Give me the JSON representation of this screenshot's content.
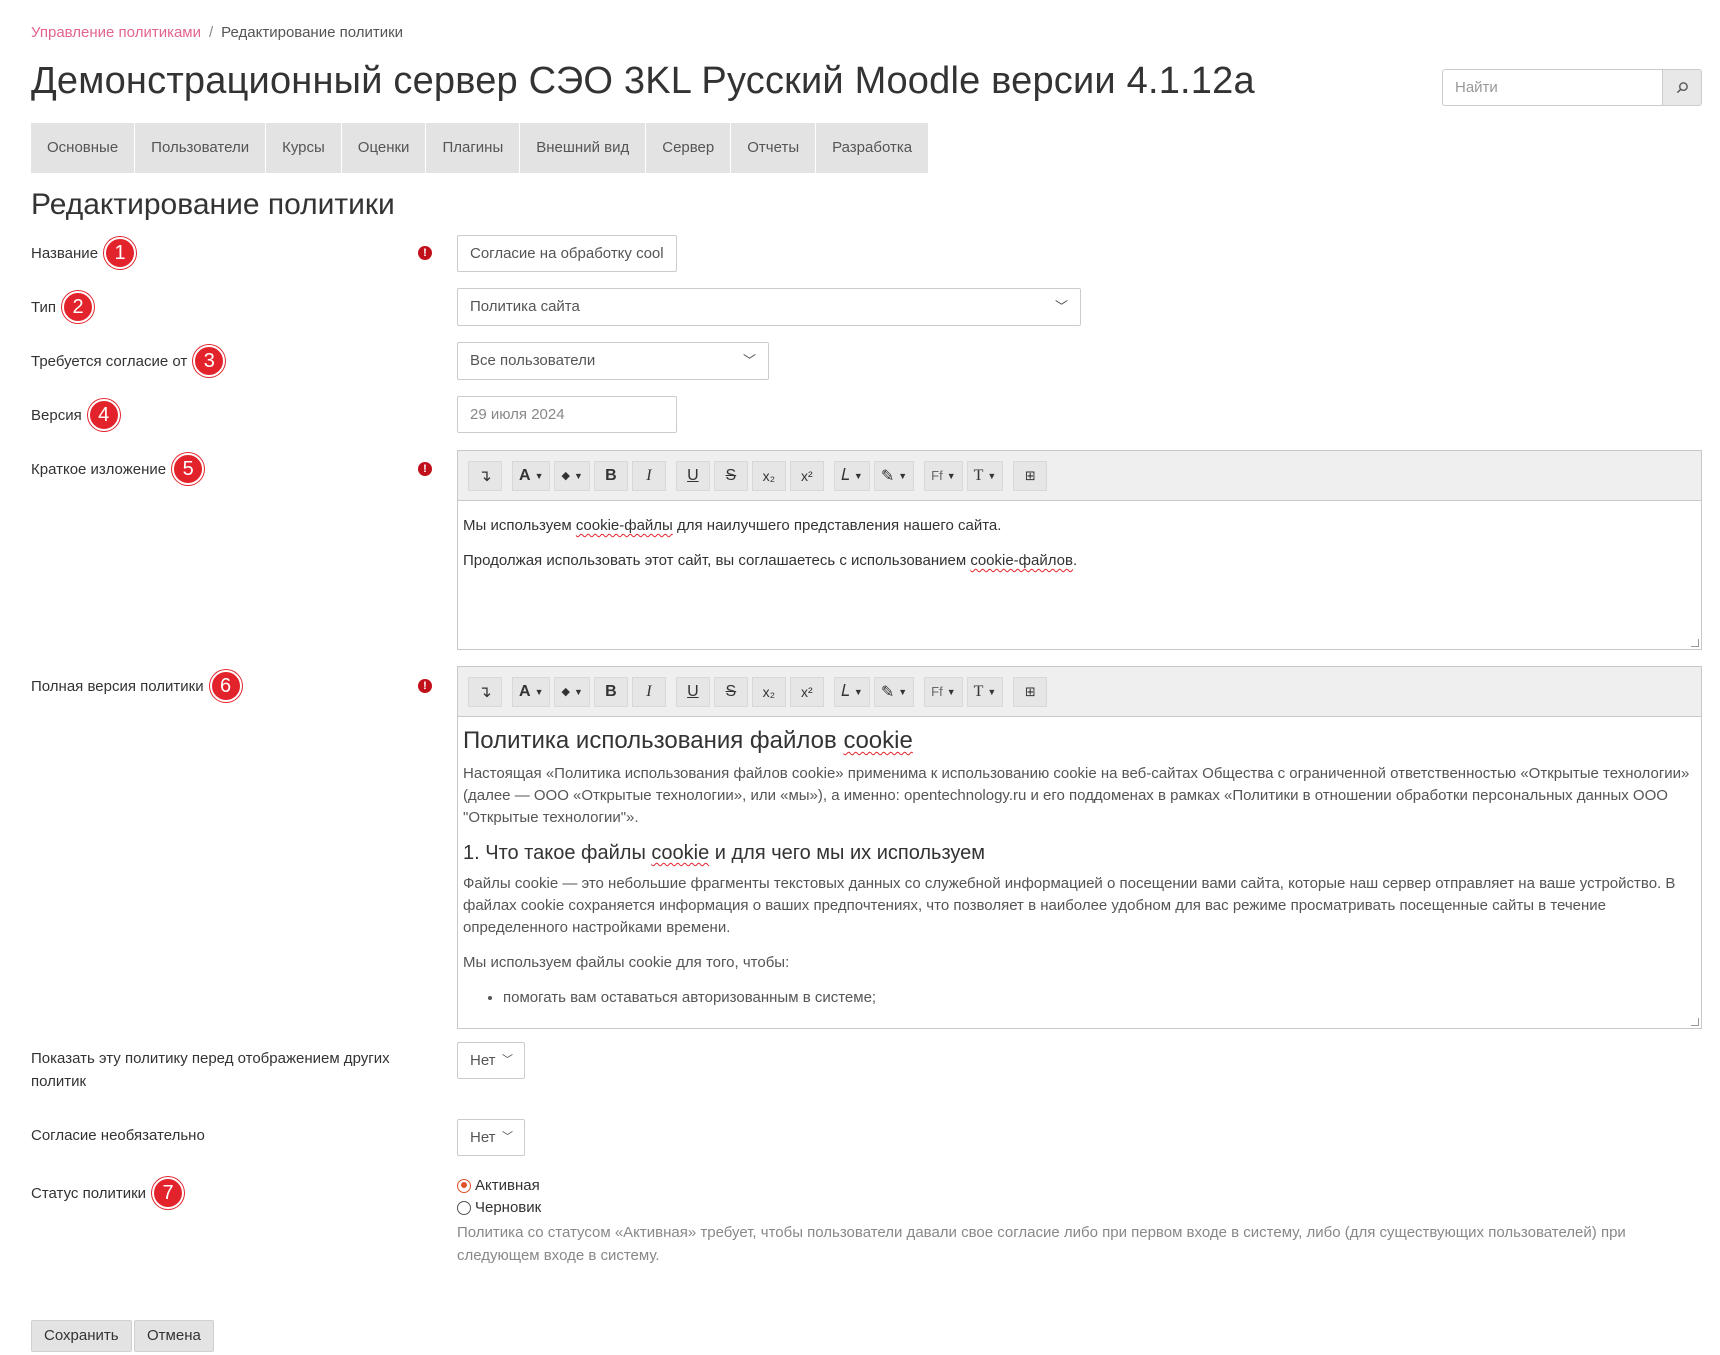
{
  "breadcrumb": {
    "link": "Управление политиками",
    "separator": "/",
    "current": "Редактирование политики"
  },
  "site_title": "Демонстрационный сервер СЭО 3KL Русский Moodle версии 4.1.12а",
  "search": {
    "placeholder": "Найти",
    "icon": "search-icon"
  },
  "nav": [
    "Основные",
    "Пользователи",
    "Курсы",
    "Оценки",
    "Плагины",
    "Внешний вид",
    "Сервер",
    "Отчеты",
    "Разработка"
  ],
  "page_heading": "Редактирование политики",
  "form": {
    "name": {
      "label": "Название",
      "badge": "1",
      "value": "Согласие на обработку cool"
    },
    "type": {
      "label": "Тип",
      "badge": "2",
      "value": "Политика сайта"
    },
    "audience": {
      "label": "Требуется согласие от",
      "badge": "3",
      "value": "Все пользователи"
    },
    "version": {
      "label": "Версия",
      "badge": "4",
      "value": "29 июля 2024"
    },
    "summary": {
      "label": "Краткое изложение",
      "badge": "5",
      "p1_a": "Мы используем ",
      "p1_b": "cookie-файлы",
      "p1_c": " для наилучшего представления нашего сайта.",
      "p2_a": "Продолжая использовать этот сайт, вы соглашаетесь с использованием ",
      "p2_b": "cookie-файлов",
      "p2_c": "."
    },
    "full": {
      "label": "Полная версия политики",
      "badge": "6",
      "title_a": "Политика использования файлов ",
      "title_b": "cookie",
      "intro": "Настоящая «Политика использования файлов cookie» применима к использованию cookie на веб-сайтах Общества с ограниченной ответственностью «Открытые технологии» (далее — ООО «Открытые технологии», или «мы»), а именно: opentechnology.ru и его поддоменах в рамках «Политики в отношении обработки персональных данных ООО \"Открытые технологии\"».",
      "h1_a": "1. Что такое файлы ",
      "h1_b": "cookie",
      "h1_c": " и для чего мы их используем",
      "para1": "Файлы cookie — это небольшие фрагменты текстовых данных со служебной информацией о посещении вами сайта, которые наш сервер отправляет на ваше устройство. В файлах cookie сохраняется информация о ваших предпочтениях, что позволяет в наиболее удобном для вас режиме просматривать посещенные сайты в течение определенного настройками времени.",
      "para2": "Мы используем файлы cookie для того, чтобы:",
      "li1": "помогать вам оставаться авторизованным в системе;"
    },
    "show_first": {
      "label": "Показать эту политику перед отображением других политик",
      "value": "Нет"
    },
    "optional": {
      "label": "Согласие необязательно",
      "value": "Нет"
    },
    "status": {
      "label": "Статус политики",
      "badge": "7",
      "options": [
        "Активная",
        "Черновик"
      ],
      "help": "Политика со статусом «Активная» требует, чтобы пользователи давали свое согласие либо при первом входе в систему, либо (для существующих пользователей) при следующем входе в систему."
    }
  },
  "toolbar": {
    "items": [
      "↴",
      "A",
      "◆",
      "B",
      "I",
      "U",
      "S",
      "x₂",
      "x²",
      "𝐿",
      "✎",
      "Ff",
      "T",
      "⊞"
    ]
  },
  "buttons": {
    "save": "Сохранить",
    "cancel": "Отмена"
  },
  "colors": {
    "accent_link": "#e3648f",
    "badge": "#e3232b",
    "required": "#c0101a",
    "radio": "#e0502a"
  }
}
